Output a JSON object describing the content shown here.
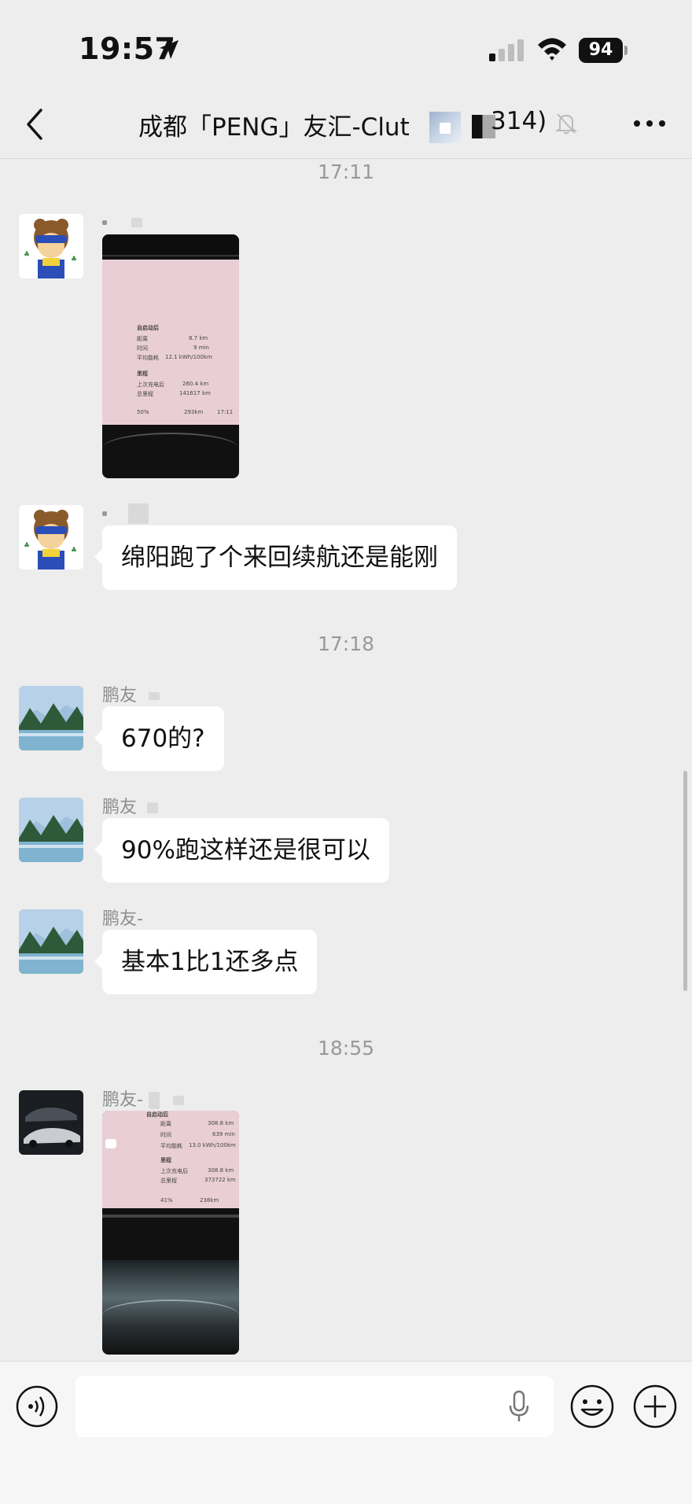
{
  "status_bar": {
    "time": "19:57",
    "battery": "94"
  },
  "nav": {
    "title": "成都「PENG」友汇-Clut",
    "member_count": "314)"
  },
  "messages": {
    "ts1": "17:11",
    "ts2": "17:18",
    "ts3": "18:55",
    "m2_text": "绵阳跑了个来回续航还是能刚",
    "m3_sender": "鹏友",
    "m3_text": "670的?",
    "m4_sender": "鹏友",
    "m4_text": "90%跑这样还是很可以",
    "m5_sender": "鹏友-",
    "m5_text": "基本1比1还多点",
    "m6_sender": "鹏友-"
  },
  "screen1": {
    "section1": "自启动后",
    "dist_label": "距离",
    "dist_value": "8.7 km",
    "time_label": "时间",
    "time_value": "9 min",
    "avg_label": "平均能耗",
    "avg_value": "12.1 kWh/100km",
    "section2": "里程",
    "last_label": "上次充电后",
    "last_value": "260.4 km",
    "total_label": "总里程",
    "total_value": "141617 km",
    "soc": "50%",
    "range": "293km",
    "clock": "17:11"
  },
  "screen2": {
    "section1": "自启动后",
    "dist_label": "距离",
    "dist_value": "308.8 km",
    "time_label": "时间",
    "time_value": "639 min",
    "avg_label": "平均能耗",
    "avg_value": "13.0 kWh/100km",
    "section2": "里程",
    "last_label": "上次充电后",
    "last_value": "308.8 km",
    "total_label": "总里程",
    "total_value": "373722 km",
    "soc": "41%",
    "range": "238km"
  },
  "icons": {
    "location": "location-arrow-icon",
    "signal": "cellular-signal-icon",
    "wifi": "wifi-icon",
    "back": "chevron-left-icon",
    "mute": "bell-slash-icon",
    "more": "ellipsis-icon",
    "voice": "voice-mode-icon",
    "mic": "microphone-icon",
    "emoji": "emoji-icon",
    "plus": "plus-icon"
  }
}
